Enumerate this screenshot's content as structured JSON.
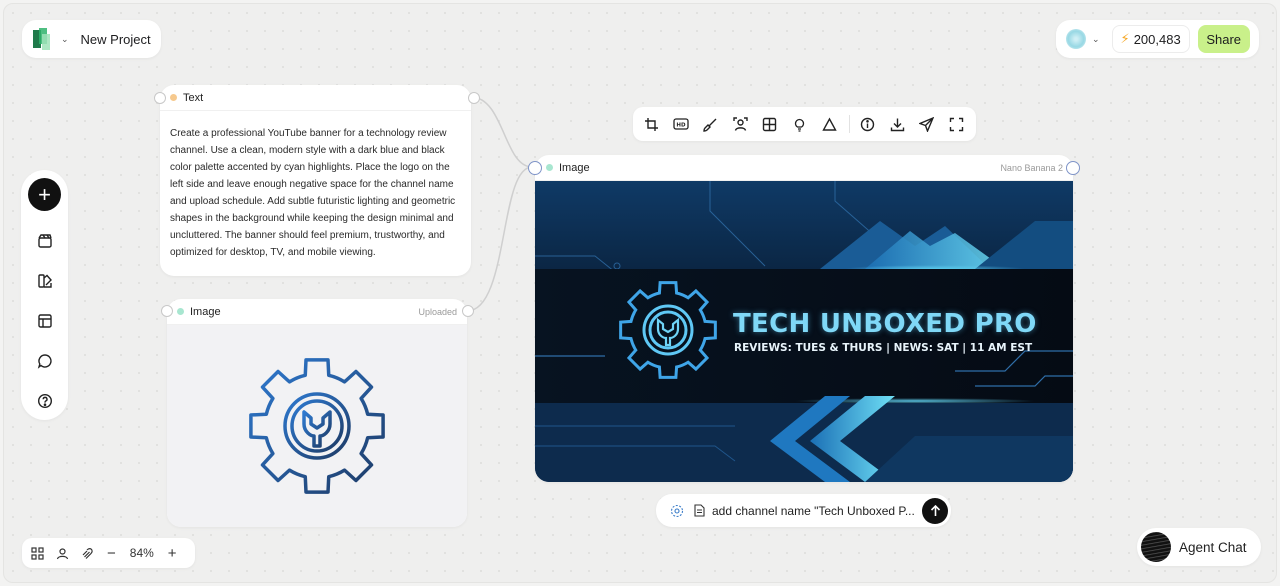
{
  "project": {
    "name": "New Project"
  },
  "header": {
    "credits": "200,483",
    "share_label": "Share"
  },
  "left_toolbar": {
    "items": [
      "add-icon",
      "clapperboard-icon",
      "palette-icon",
      "layout-icon",
      "chat-icon",
      "help-icon"
    ]
  },
  "zoom": {
    "value": "84%",
    "minus": "−",
    "plus": "+"
  },
  "text_node": {
    "title": "Text",
    "body": "Create a professional YouTube banner for a technology review channel. Use a clean, modern style with a dark blue and black color palette accented by cyan highlights. Place the logo on the left side and leave enough negative space for the channel name and upload schedule. Add subtle futuristic lighting and geometric shapes in the background while keeping the design minimal and uncluttered. The banner should feel premium, trustworthy, and optimized for desktop, TV, and mobile viewing."
  },
  "upload_node": {
    "title": "Image",
    "meta": "Uploaded"
  },
  "image_node": {
    "title": "Image",
    "model": "Nano Banana 2"
  },
  "banner": {
    "title": "TECH UNBOXED PRO",
    "subtitle": "REVIEWS: TUES & THURS | NEWS: SAT | 11 AM EST"
  },
  "image_toolbar": {
    "icons": [
      "crop-icon",
      "hd-icon",
      "brush-icon",
      "person-icon",
      "grid-icon",
      "light-icon",
      "triangle-icon",
      "info-icon",
      "download-icon",
      "send-icon",
      "fullscreen-icon"
    ]
  },
  "prompt": {
    "text": "add channel name \"Tech Unboxed P..."
  },
  "agent_chat": {
    "label": "Agent Chat"
  },
  "colors": {
    "accent_green": "#c9f08a",
    "dark": "#111111",
    "cyan": "#5fd0f0",
    "text_node_dot": "#f6c98e",
    "image_node_dot": "#a8e6d0"
  }
}
